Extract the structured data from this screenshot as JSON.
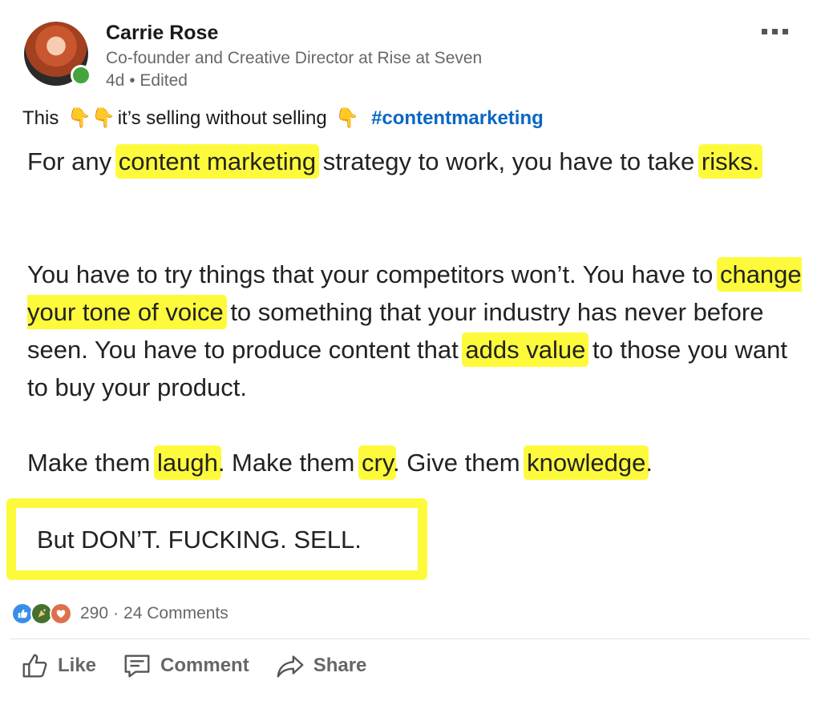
{
  "author": {
    "name": "Carrie Rose",
    "headline": "Co-founder and Creative Director at Rise at Seven",
    "time": "4d",
    "edited": "Edited",
    "meta_separator": "•"
  },
  "caption": {
    "pre": "This",
    "mid": "it’s selling without selling",
    "hashtag": "#contentmarketing",
    "emoji": "👇"
  },
  "image_text": {
    "p1": [
      "For any ",
      "content marketing",
      " strategy to work, you have to take ",
      "risks."
    ],
    "p2": [
      "You have to try things that your competitors won’t. You have to ",
      "change your tone of voice",
      " to something that your industry has never before seen. You have to produce content that ",
      "adds value",
      " to those you want to buy your product."
    ],
    "p3": [
      "Make them ",
      "laugh",
      ". Make them ",
      "cry",
      ". Give them ",
      "knowledge",
      "."
    ],
    "p4": "But DON’T. FUCKING. SELL.",
    "highlight_color": "#fdfa3c"
  },
  "social": {
    "reactions": [
      "like-icon",
      "celebrate-icon",
      "love-icon"
    ],
    "count": "290",
    "separator": "·",
    "comments": "24 Comments"
  },
  "actions": {
    "like": "Like",
    "comment": "Comment",
    "share": "Share"
  },
  "colors": {
    "presence": "#45a53a",
    "hashtag": "#0a66c2"
  }
}
